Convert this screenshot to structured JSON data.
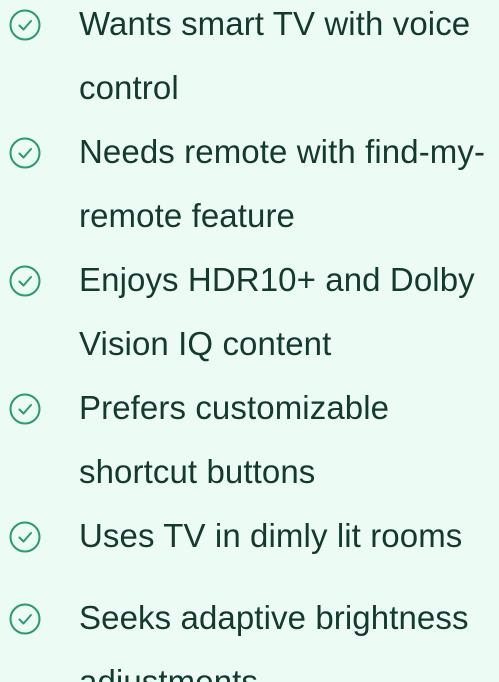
{
  "checklist": {
    "accent_color": "#2a9a6c",
    "icon": "check-circle-icon",
    "items": [
      {
        "label": "Wants smart TV with voice control"
      },
      {
        "label": "Needs remote with find-my-remote feature"
      },
      {
        "label": "Enjoys HDR10+ and Dolby Vision IQ content"
      },
      {
        "label": "Prefers customizable shortcut buttons"
      },
      {
        "label": "Uses TV in dimly lit rooms"
      },
      {
        "label": "Seeks adaptive brightness adjustments"
      }
    ]
  }
}
